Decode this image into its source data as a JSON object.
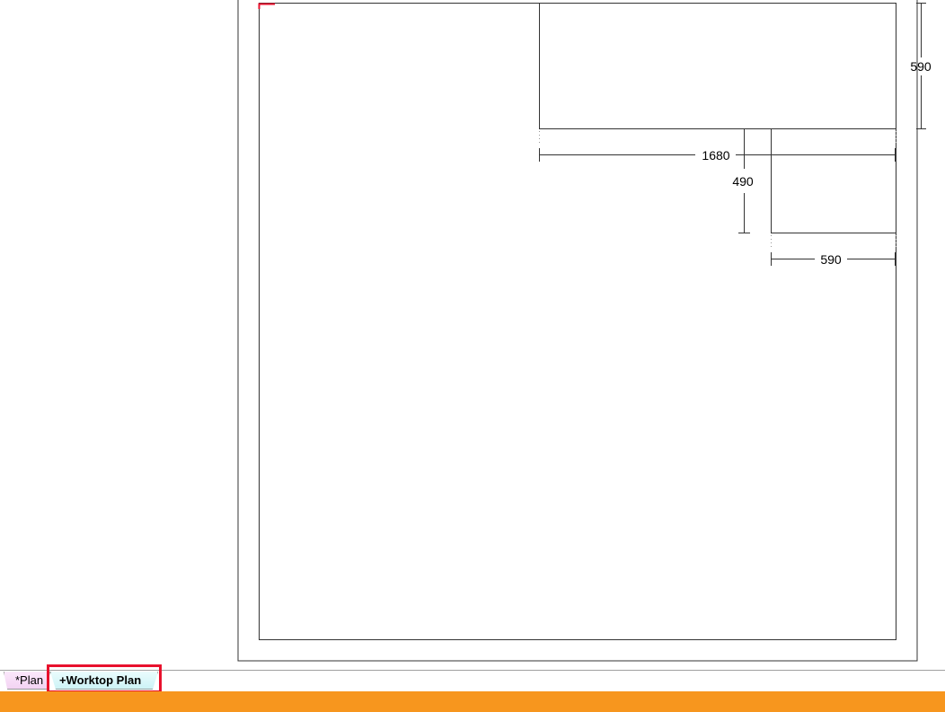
{
  "drawing": {
    "dimensions": {
      "upper_unit_width": "1680",
      "upper_unit_depth": "590",
      "side_unit_depth": "490",
      "side_unit_width": "590"
    }
  },
  "tabs": [
    {
      "label": "*Plan",
      "active": false
    },
    {
      "label": "+Worktop Plan",
      "active": true
    }
  ],
  "colors": {
    "status_bar": "#f7961e",
    "highlight": "#e8112d",
    "cursor_mark": "#e8112d"
  }
}
